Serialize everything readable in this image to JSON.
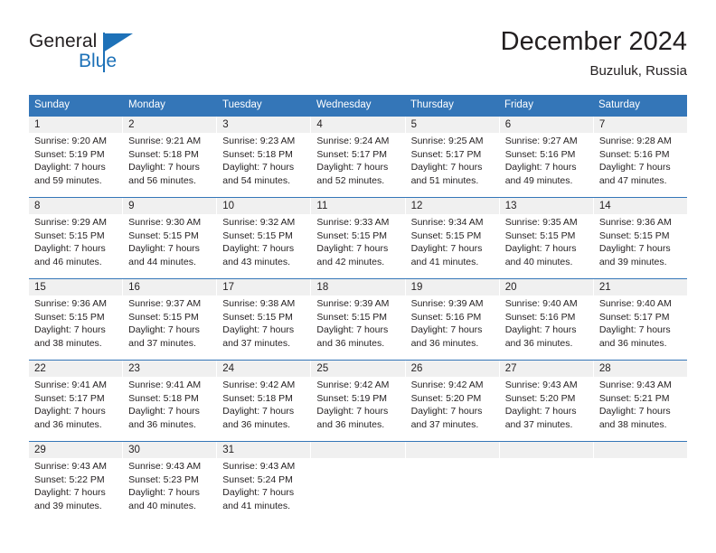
{
  "brand": {
    "name_part1": "General",
    "name_part2": "Blue",
    "accent_color": "#1d71b8"
  },
  "header": {
    "title": "December 2024",
    "location": "Buzuluk, Russia"
  },
  "theme": {
    "header_blue": "#3476b8",
    "daynum_band": "#f0f0f0",
    "text": "#231f20"
  },
  "weekdays": [
    "Sunday",
    "Monday",
    "Tuesday",
    "Wednesday",
    "Thursday",
    "Friday",
    "Saturday"
  ],
  "weeks": [
    [
      {
        "day": "1",
        "sunrise": "Sunrise: 9:20 AM",
        "sunset": "Sunset: 5:19 PM",
        "daylight1": "Daylight: 7 hours",
        "daylight2": "and 59 minutes."
      },
      {
        "day": "2",
        "sunrise": "Sunrise: 9:21 AM",
        "sunset": "Sunset: 5:18 PM",
        "daylight1": "Daylight: 7 hours",
        "daylight2": "and 56 minutes."
      },
      {
        "day": "3",
        "sunrise": "Sunrise: 9:23 AM",
        "sunset": "Sunset: 5:18 PM",
        "daylight1": "Daylight: 7 hours",
        "daylight2": "and 54 minutes."
      },
      {
        "day": "4",
        "sunrise": "Sunrise: 9:24 AM",
        "sunset": "Sunset: 5:17 PM",
        "daylight1": "Daylight: 7 hours",
        "daylight2": "and 52 minutes."
      },
      {
        "day": "5",
        "sunrise": "Sunrise: 9:25 AM",
        "sunset": "Sunset: 5:17 PM",
        "daylight1": "Daylight: 7 hours",
        "daylight2": "and 51 minutes."
      },
      {
        "day": "6",
        "sunrise": "Sunrise: 9:27 AM",
        "sunset": "Sunset: 5:16 PM",
        "daylight1": "Daylight: 7 hours",
        "daylight2": "and 49 minutes."
      },
      {
        "day": "7",
        "sunrise": "Sunrise: 9:28 AM",
        "sunset": "Sunset: 5:16 PM",
        "daylight1": "Daylight: 7 hours",
        "daylight2": "and 47 minutes."
      }
    ],
    [
      {
        "day": "8",
        "sunrise": "Sunrise: 9:29 AM",
        "sunset": "Sunset: 5:15 PM",
        "daylight1": "Daylight: 7 hours",
        "daylight2": "and 46 minutes."
      },
      {
        "day": "9",
        "sunrise": "Sunrise: 9:30 AM",
        "sunset": "Sunset: 5:15 PM",
        "daylight1": "Daylight: 7 hours",
        "daylight2": "and 44 minutes."
      },
      {
        "day": "10",
        "sunrise": "Sunrise: 9:32 AM",
        "sunset": "Sunset: 5:15 PM",
        "daylight1": "Daylight: 7 hours",
        "daylight2": "and 43 minutes."
      },
      {
        "day": "11",
        "sunrise": "Sunrise: 9:33 AM",
        "sunset": "Sunset: 5:15 PM",
        "daylight1": "Daylight: 7 hours",
        "daylight2": "and 42 minutes."
      },
      {
        "day": "12",
        "sunrise": "Sunrise: 9:34 AM",
        "sunset": "Sunset: 5:15 PM",
        "daylight1": "Daylight: 7 hours",
        "daylight2": "and 41 minutes."
      },
      {
        "day": "13",
        "sunrise": "Sunrise: 9:35 AM",
        "sunset": "Sunset: 5:15 PM",
        "daylight1": "Daylight: 7 hours",
        "daylight2": "and 40 minutes."
      },
      {
        "day": "14",
        "sunrise": "Sunrise: 9:36 AM",
        "sunset": "Sunset: 5:15 PM",
        "daylight1": "Daylight: 7 hours",
        "daylight2": "and 39 minutes."
      }
    ],
    [
      {
        "day": "15",
        "sunrise": "Sunrise: 9:36 AM",
        "sunset": "Sunset: 5:15 PM",
        "daylight1": "Daylight: 7 hours",
        "daylight2": "and 38 minutes."
      },
      {
        "day": "16",
        "sunrise": "Sunrise: 9:37 AM",
        "sunset": "Sunset: 5:15 PM",
        "daylight1": "Daylight: 7 hours",
        "daylight2": "and 37 minutes."
      },
      {
        "day": "17",
        "sunrise": "Sunrise: 9:38 AM",
        "sunset": "Sunset: 5:15 PM",
        "daylight1": "Daylight: 7 hours",
        "daylight2": "and 37 minutes."
      },
      {
        "day": "18",
        "sunrise": "Sunrise: 9:39 AM",
        "sunset": "Sunset: 5:15 PM",
        "daylight1": "Daylight: 7 hours",
        "daylight2": "and 36 minutes."
      },
      {
        "day": "19",
        "sunrise": "Sunrise: 9:39 AM",
        "sunset": "Sunset: 5:16 PM",
        "daylight1": "Daylight: 7 hours",
        "daylight2": "and 36 minutes."
      },
      {
        "day": "20",
        "sunrise": "Sunrise: 9:40 AM",
        "sunset": "Sunset: 5:16 PM",
        "daylight1": "Daylight: 7 hours",
        "daylight2": "and 36 minutes."
      },
      {
        "day": "21",
        "sunrise": "Sunrise: 9:40 AM",
        "sunset": "Sunset: 5:17 PM",
        "daylight1": "Daylight: 7 hours",
        "daylight2": "and 36 minutes."
      }
    ],
    [
      {
        "day": "22",
        "sunrise": "Sunrise: 9:41 AM",
        "sunset": "Sunset: 5:17 PM",
        "daylight1": "Daylight: 7 hours",
        "daylight2": "and 36 minutes."
      },
      {
        "day": "23",
        "sunrise": "Sunrise: 9:41 AM",
        "sunset": "Sunset: 5:18 PM",
        "daylight1": "Daylight: 7 hours",
        "daylight2": "and 36 minutes."
      },
      {
        "day": "24",
        "sunrise": "Sunrise: 9:42 AM",
        "sunset": "Sunset: 5:18 PM",
        "daylight1": "Daylight: 7 hours",
        "daylight2": "and 36 minutes."
      },
      {
        "day": "25",
        "sunrise": "Sunrise: 9:42 AM",
        "sunset": "Sunset: 5:19 PM",
        "daylight1": "Daylight: 7 hours",
        "daylight2": "and 36 minutes."
      },
      {
        "day": "26",
        "sunrise": "Sunrise: 9:42 AM",
        "sunset": "Sunset: 5:20 PM",
        "daylight1": "Daylight: 7 hours",
        "daylight2": "and 37 minutes."
      },
      {
        "day": "27",
        "sunrise": "Sunrise: 9:43 AM",
        "sunset": "Sunset: 5:20 PM",
        "daylight1": "Daylight: 7 hours",
        "daylight2": "and 37 minutes."
      },
      {
        "day": "28",
        "sunrise": "Sunrise: 9:43 AM",
        "sunset": "Sunset: 5:21 PM",
        "daylight1": "Daylight: 7 hours",
        "daylight2": "and 38 minutes."
      }
    ],
    [
      {
        "day": "29",
        "sunrise": "Sunrise: 9:43 AM",
        "sunset": "Sunset: 5:22 PM",
        "daylight1": "Daylight: 7 hours",
        "daylight2": "and 39 minutes."
      },
      {
        "day": "30",
        "sunrise": "Sunrise: 9:43 AM",
        "sunset": "Sunset: 5:23 PM",
        "daylight1": "Daylight: 7 hours",
        "daylight2": "and 40 minutes."
      },
      {
        "day": "31",
        "sunrise": "Sunrise: 9:43 AM",
        "sunset": "Sunset: 5:24 PM",
        "daylight1": "Daylight: 7 hours",
        "daylight2": "and 41 minutes."
      },
      {
        "day": "",
        "sunrise": "",
        "sunset": "",
        "daylight1": "",
        "daylight2": ""
      },
      {
        "day": "",
        "sunrise": "",
        "sunset": "",
        "daylight1": "",
        "daylight2": ""
      },
      {
        "day": "",
        "sunrise": "",
        "sunset": "",
        "daylight1": "",
        "daylight2": ""
      },
      {
        "day": "",
        "sunrise": "",
        "sunset": "",
        "daylight1": "",
        "daylight2": ""
      }
    ]
  ]
}
